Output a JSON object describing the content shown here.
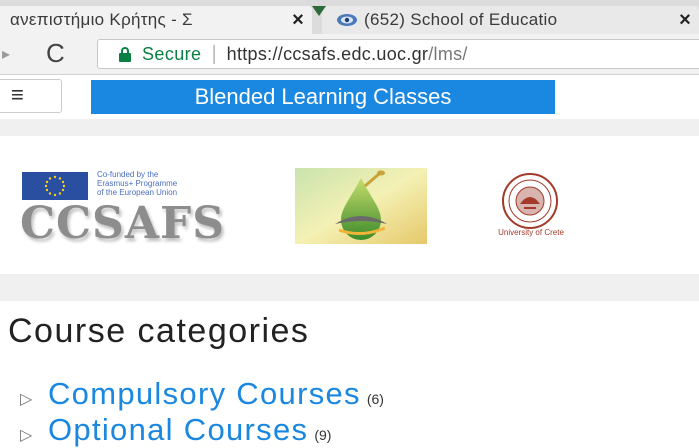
{
  "browser": {
    "tabs": [
      {
        "title": "ανεπιστήμιο Κρήτης - Σ",
        "close": "×"
      },
      {
        "title": "(652) School of Educatio",
        "close": "×"
      }
    ],
    "secure_label": "Secure",
    "separator": "|",
    "url_host": "https://ccsafs.edc.uoc.gr",
    "url_path": "/lms/"
  },
  "header": {
    "menu_icon": "≡",
    "site_title": "Blended Learning Classes"
  },
  "logos": {
    "erasmus_text": [
      "Co-funded by the",
      "Erasmus+ Programme",
      "of the European Union"
    ],
    "ccsafs": "CCSAFS",
    "uoc_caption": "University of Crete"
  },
  "main": {
    "heading": "Course categories",
    "categories": [
      {
        "label": "Compulsory Courses",
        "count": "(6)"
      },
      {
        "label": "Optional Courses",
        "count": "(9)"
      }
    ]
  },
  "icons": {
    "reload": "C",
    "forward": "▸",
    "bullet": "▷"
  },
  "colors": {
    "accent": "#1a87e0",
    "secure": "#0b8043"
  }
}
